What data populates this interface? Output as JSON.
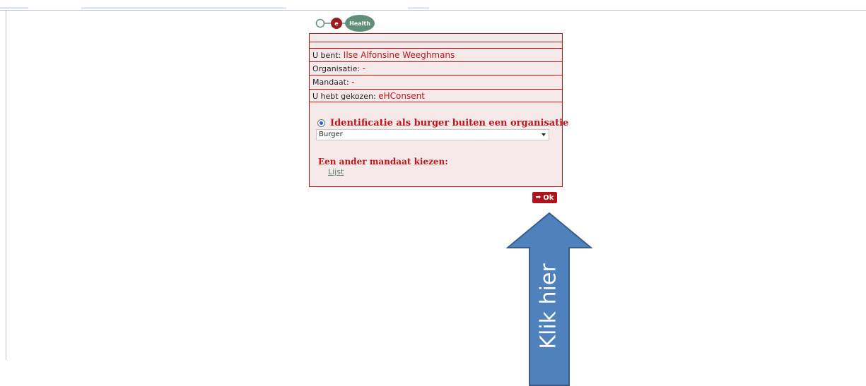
{
  "logo": {
    "brand_text": "Health",
    "letter": "e"
  },
  "panel": {
    "user_label": "U bent:",
    "user_value": "Ilse Alfonsine Weeghmans",
    "organisation_label": "Organisatie:",
    "organisation_value": "-",
    "mandate_label": "Mandaat:",
    "mandate_value": "-",
    "chosen_label": "U hebt gekozen:",
    "chosen_value": "eHConsent"
  },
  "identification": {
    "radio_label": "Identificatie als burger buiten een organisatie",
    "radio_selected": true,
    "select_value": "Burger"
  },
  "mandate_choice": {
    "heading": "Een ander mandaat kiezen:",
    "link_label": "Lijst"
  },
  "ok_button": {
    "label": "Ok",
    "icon": "arrow-right-icon"
  },
  "annotation": {
    "arrow_text": "Klik hier",
    "arrow_color": "#4f81bd",
    "arrow_border": "#385d8a"
  },
  "colors": {
    "accent_red": "#c2151b",
    "panel_bg": "#f6e9ea",
    "logo_green": "#5f8f7a"
  }
}
